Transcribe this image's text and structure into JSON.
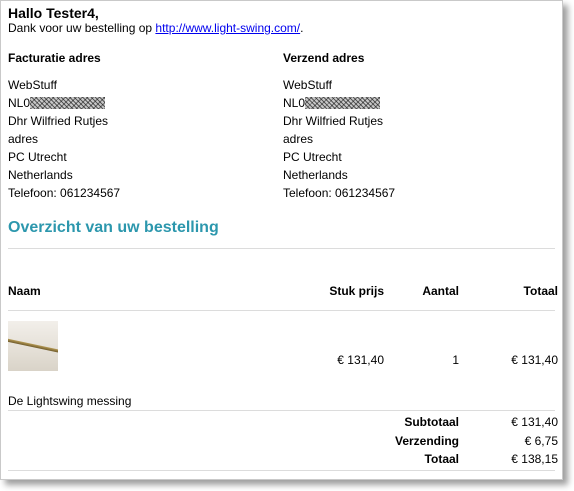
{
  "greeting": "Hallo Tester4,",
  "thanks": {
    "text": "Dank voor uw bestelling op ",
    "link": "http://www.light-swing.com/",
    "suffix": "."
  },
  "billing": {
    "title": "Facturatie adres",
    "company": "WebStuff",
    "vat_prefix": "NL0",
    "name": "Dhr Wilfried Rutjes",
    "street": "adres",
    "city": "PC Utrecht",
    "country": "Netherlands",
    "phone": "Telefoon: 061234567"
  },
  "shipping": {
    "title": "Verzend adres",
    "company": "WebStuff",
    "vat_prefix": "NL0",
    "name": "Dhr Wilfried Rutjes",
    "street": "adres",
    "city": "PC Utrecht",
    "country": "Netherlands",
    "phone": "Telefoon: 061234567"
  },
  "overview_title": "Overzicht van uw bestelling",
  "table": {
    "headers": {
      "name": "Naam",
      "unit_price": "Stuk prijs",
      "quantity": "Aantal",
      "total": "Totaal"
    },
    "rows": [
      {
        "unit_price": "€ 131,40",
        "quantity": "1",
        "total": "€ 131,40",
        "product_name": "De Lightswing messing"
      }
    ]
  },
  "summary": {
    "subtotal_label": "Subtotaal",
    "subtotal_value": "€ 131,40",
    "shipping_label": "Verzending",
    "shipping_value": "€ 6,75",
    "total_label": "Totaal",
    "total_value": "€ 138,15"
  }
}
